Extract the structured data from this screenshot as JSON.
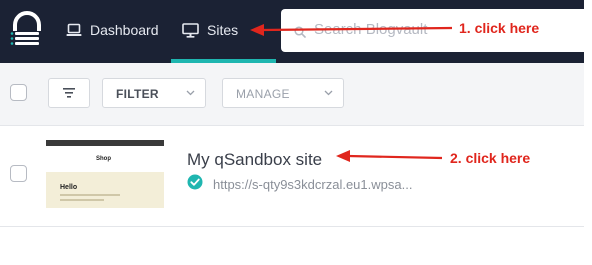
{
  "nav": {
    "items": [
      {
        "label": "Dashboard",
        "icon": "laptop-icon"
      },
      {
        "label": "Sites",
        "icon": "monitor-icon"
      }
    ],
    "active": "Sites"
  },
  "search": {
    "placeholder": "Search Blogvault"
  },
  "toolbar": {
    "filter_label": "FILTER",
    "manage_label": "MANAGE"
  },
  "sites": [
    {
      "name": "My qSandbox site",
      "url": "https://s-qty9s3kdcrzal.eu1.wpsa...",
      "verified": true,
      "thumbnail": {
        "page_title": "Shop",
        "heading": "Hello"
      }
    }
  ],
  "annotations": [
    "1. click here",
    "2. click here"
  ],
  "colors": {
    "topbar": "#1b2234",
    "accent": "#1fb6b0",
    "annotation": "#e0261d"
  }
}
